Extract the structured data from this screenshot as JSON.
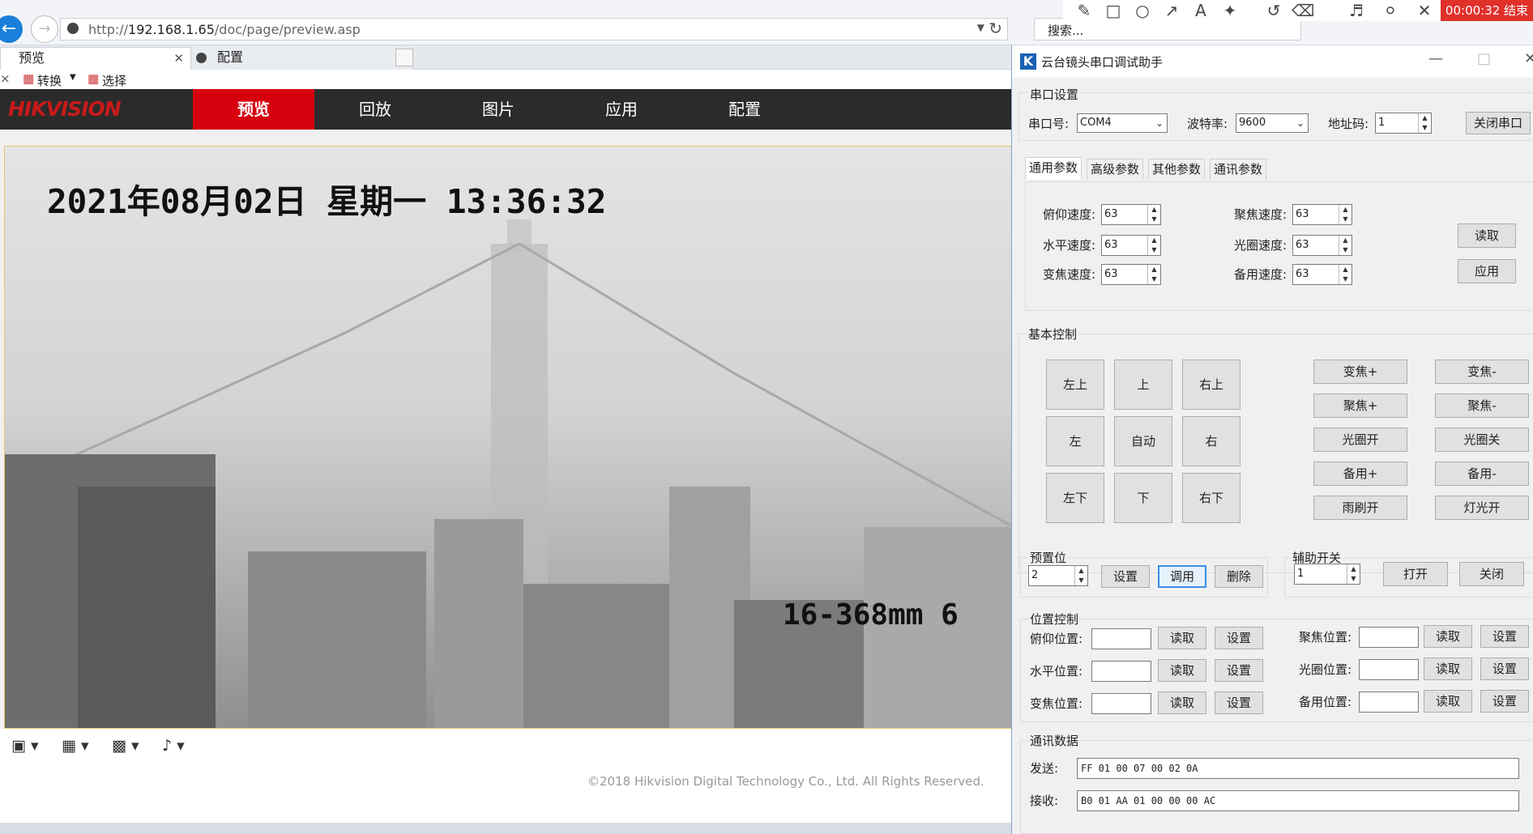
{
  "browser": {
    "url_prefix": "http://",
    "url_host": "192.168.1.65",
    "url_path": "/doc/page/preview.asp",
    "search_placeholder": "搜索...",
    "tabs": [
      {
        "label": "预览"
      },
      {
        "label": "配置"
      }
    ],
    "cmd_convert": "转换",
    "cmd_select": "选择",
    "rec_timer": "00:00:32 结束"
  },
  "hik": {
    "logo": "HIKVISION",
    "nav": [
      "预览",
      "回放",
      "图片",
      "应用",
      "配置"
    ],
    "osd_time": "2021年08月02日 星期一 13:36:32",
    "osd_zoom": "16-368mm 6",
    "copyright": "©2018 Hikvision Digital Technology Co., Ltd. All Rights Reserved."
  },
  "dialog": {
    "title": "云台镜头串口调试助手",
    "serial": {
      "group_label": "串口设置",
      "port_label": "串口号:",
      "port_value": "COM4",
      "baud_label": "波特率:",
      "baud_value": "9600",
      "addr_label": "地址码:",
      "addr_value": "1",
      "close_button": "关闭串口"
    },
    "tabs": [
      "通用参数",
      "高级参数",
      "其他参数",
      "通讯参数"
    ],
    "speeds": {
      "tilt_label": "俯仰速度:",
      "tilt": "63",
      "pan_label": "水平速度:",
      "pan": "63",
      "zoom_label": "变焦速度:",
      "zoom": "63",
      "focus_label": "聚焦速度:",
      "focus": "63",
      "iris_label": "光圈速度:",
      "iris": "63",
      "spare_label": "备用速度:",
      "spare": "63",
      "read_button": "读取",
      "apply_button": "应用"
    },
    "basic": {
      "group_label": "基本控制",
      "dir": [
        "左上",
        "上",
        "右上",
        "左",
        "自动",
        "右",
        "左下",
        "下",
        "右下"
      ],
      "lens_left": [
        "变焦+",
        "聚焦+",
        "光圈开",
        "备用+",
        "雨刷开"
      ],
      "lens_right": [
        "变焦-",
        "聚焦-",
        "光圈关",
        "备用-",
        "灯光开"
      ]
    },
    "preset": {
      "group_label": "预置位",
      "value": "2",
      "set": "设置",
      "call": "调用",
      "delete": "删除"
    },
    "aux": {
      "group_label": "辅助开关",
      "value": "1",
      "on": "打开",
      "off": "关闭"
    },
    "position": {
      "group_label": "位置控制",
      "read": "读取",
      "set": "设置",
      "tilt_label": "俯仰位置:",
      "pan_label": "水平位置:",
      "zoom_label": "变焦位置:",
      "focus_label": "聚焦位置:",
      "iris_label": "光圈位置:",
      "spare_label": "备用位置:"
    },
    "comm": {
      "group_label": "通讯数据",
      "send_label": "发送:",
      "send_value": "FF 01 00 07 00 02 0A",
      "recv_label": "接收:",
      "recv_value": "B0 01 AA 01 00 00 00 AC"
    }
  }
}
